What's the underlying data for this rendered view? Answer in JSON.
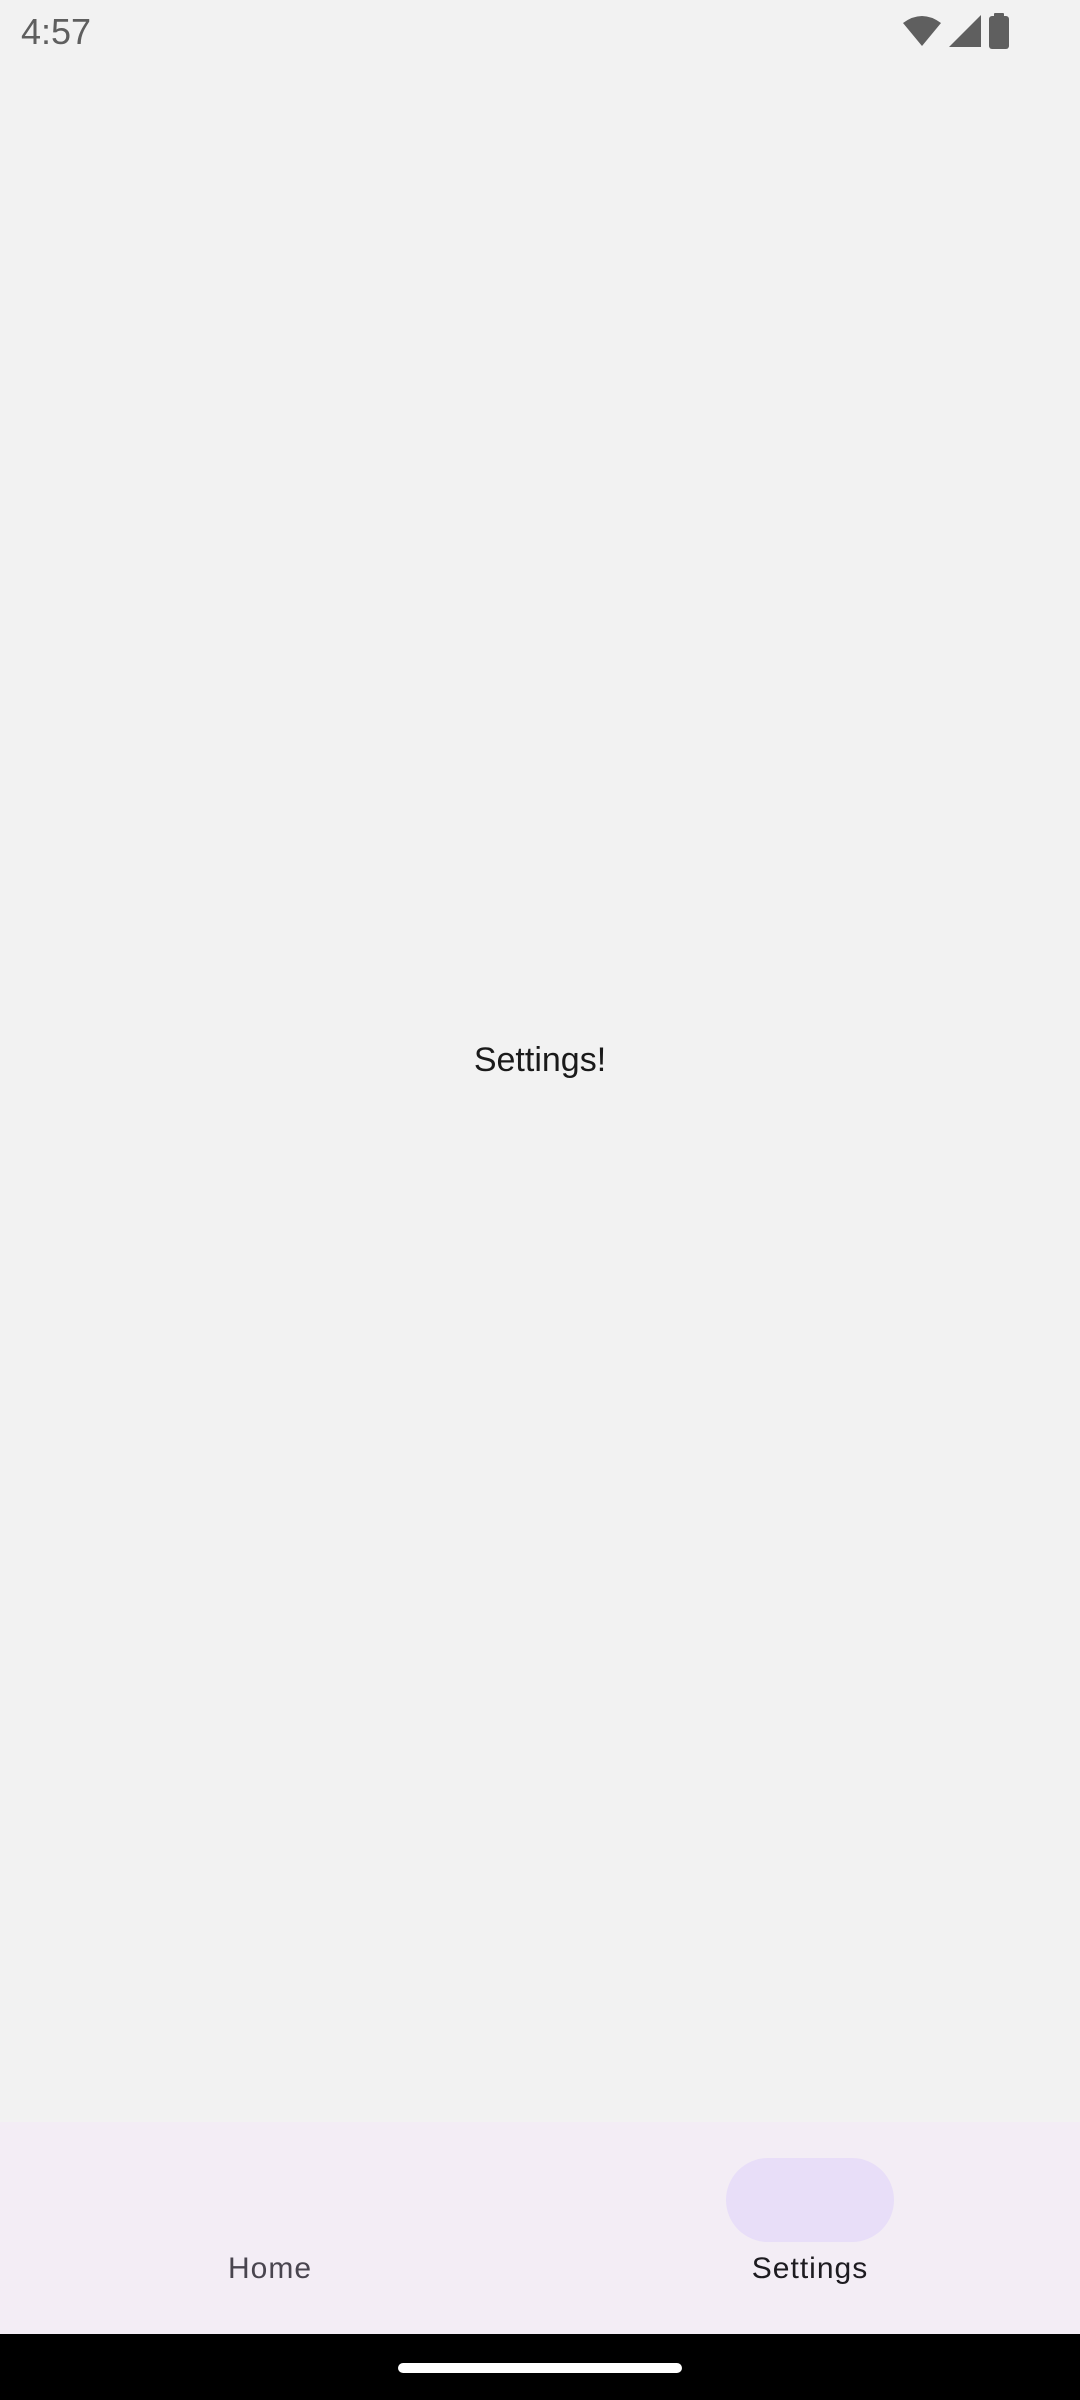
{
  "status_bar": {
    "time": "4:57",
    "icons": [
      "wifi-icon",
      "cellular-signal-icon",
      "battery-icon"
    ]
  },
  "main": {
    "message": "Settings!"
  },
  "bottom_nav": {
    "items": [
      {
        "label": "Home",
        "selected": false
      },
      {
        "label": "Settings",
        "selected": true
      }
    ]
  },
  "colors": {
    "background": "#f2f2f2",
    "nav_background": "#f3edf5",
    "nav_indicator": "#e8def8",
    "system_bar": "#000000"
  }
}
